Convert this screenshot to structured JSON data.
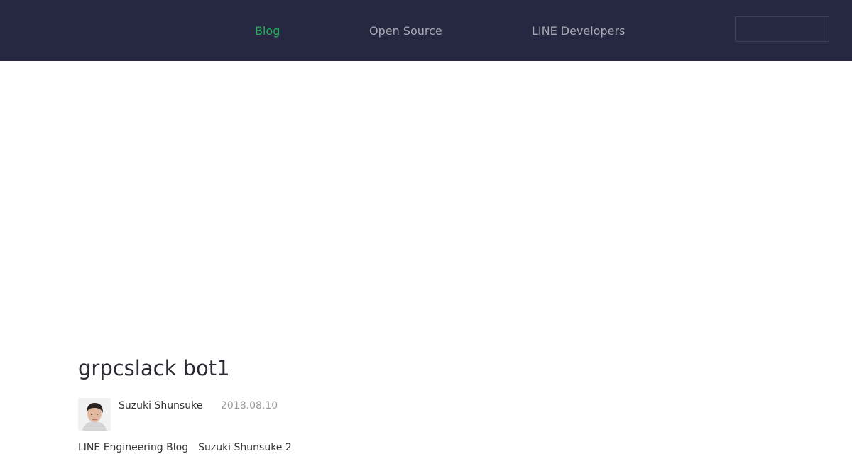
{
  "nav": {
    "links": [
      {
        "label": "Blog",
        "active": true
      },
      {
        "label": "Open Source",
        "active": false
      },
      {
        "label": "LINE Developers",
        "active": false
      }
    ],
    "search": {
      "placeholder": ""
    }
  },
  "article": {
    "title": "grpcslack bot1",
    "author": "Suzuki Shunsuke",
    "date": "2018.08.10",
    "excerpt": "LINE Engineering Blog　Suzuki Shunsuke 2"
  },
  "colors": {
    "header_bg": "#252840",
    "nav_active": "#21b459",
    "nav_inactive": "#a7a8b0",
    "title_text": "#2b2b35",
    "date_text": "#9a9a9a"
  },
  "icons": {
    "avatar": "author-avatar-photo"
  }
}
